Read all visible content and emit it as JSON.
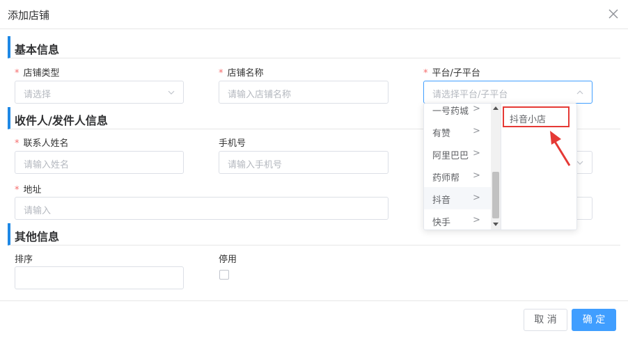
{
  "dialog": {
    "title": "添加店铺"
  },
  "sections": {
    "basic": "基本信息",
    "contact": "收件人/发件人信息",
    "other": "其他信息"
  },
  "fields": {
    "store_type": {
      "label": "店铺类型",
      "placeholder": "请选择"
    },
    "store_name": {
      "label": "店铺名称",
      "placeholder": "请输入店铺名称"
    },
    "platform": {
      "label": "平台/子平台",
      "placeholder": "请选择平台/子平台"
    },
    "contact_name": {
      "label": "联系人姓名",
      "placeholder": "请输入姓名"
    },
    "phone": {
      "label": "手机号",
      "placeholder": "请输入手机号"
    },
    "address": {
      "label": "地址",
      "placeholder": "请输入"
    },
    "sort": {
      "label": "排序"
    },
    "disabled": {
      "label": "停用"
    }
  },
  "required_mark": "*",
  "cascader": {
    "level1": [
      {
        "label": "一号药城",
        "arrow": ">"
      },
      {
        "label": "有赞",
        "arrow": ">"
      },
      {
        "label": "阿里巴巴",
        "arrow": ">"
      },
      {
        "label": "药师帮",
        "arrow": ">"
      },
      {
        "label": "抖音",
        "arrow": ">",
        "active": true
      },
      {
        "label": "快手",
        "arrow": ">"
      }
    ],
    "level2": [
      {
        "label": "抖音小店"
      }
    ]
  },
  "buttons": {
    "cancel": "取 消",
    "confirm": "确 定"
  },
  "colors": {
    "primary": "#409eff",
    "section_bar": "#1e88e5",
    "required": "#f56c6c",
    "highlight": "#e53935"
  }
}
